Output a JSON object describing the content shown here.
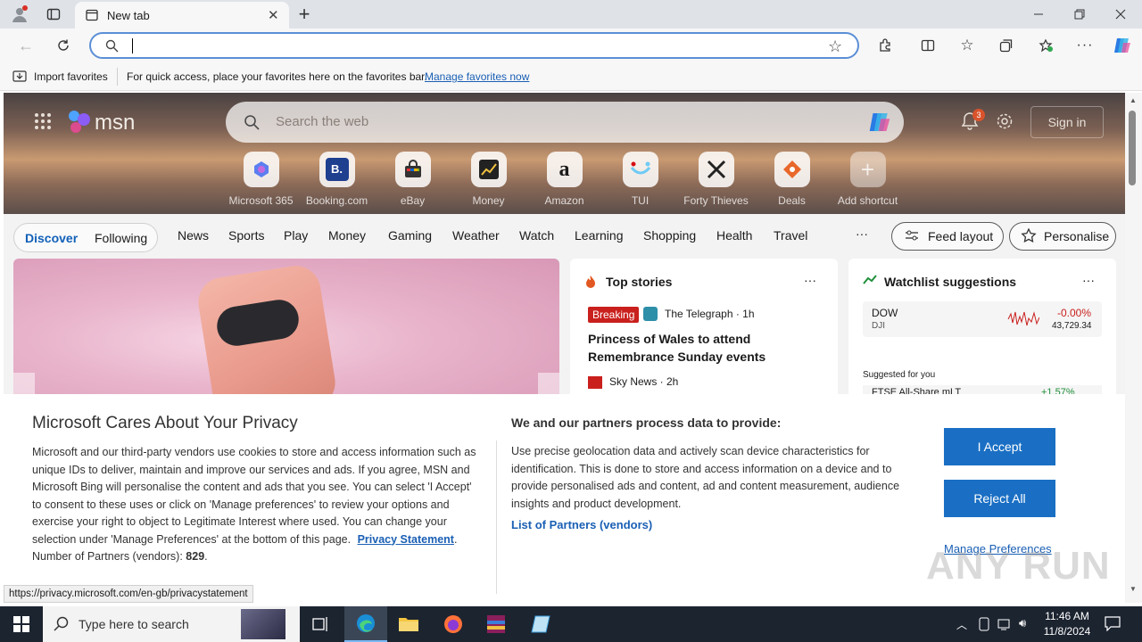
{
  "browser": {
    "tab_title": "New tab",
    "address_value": "",
    "favbar": {
      "import_label": "Import favorites",
      "hint_text": "For quick access, place your favorites here on the favorites bar.",
      "manage_link": "Manage favorites now"
    }
  },
  "msn": {
    "logo_text": "msn",
    "search_placeholder": "Search the web",
    "notification_count": "3",
    "sign_in_label": "Sign in",
    "shortcuts": [
      {
        "label": "Microsoft 365",
        "icon": "m365-icon"
      },
      {
        "label": "Booking.com",
        "icon": "booking-icon",
        "glyph": "B."
      },
      {
        "label": "eBay",
        "icon": "ebay-icon"
      },
      {
        "label": "Money",
        "icon": "money-icon"
      },
      {
        "label": "Amazon",
        "icon": "amazon-icon",
        "glyph": "a"
      },
      {
        "label": "TUI",
        "icon": "tui-icon"
      },
      {
        "label": "Forty Thieves",
        "icon": "forty-thieves-icon"
      },
      {
        "label": "Deals",
        "icon": "deals-icon"
      },
      {
        "label": "Add shortcut",
        "icon": "plus-icon",
        "glyph": "+"
      }
    ],
    "tabs": {
      "discover": "Discover",
      "following": "Following"
    },
    "nav_items": [
      "News",
      "Sports",
      "Play",
      "Money",
      "Gaming",
      "Weather",
      "Watch",
      "Learning",
      "Shopping",
      "Health",
      "Travel"
    ],
    "more_label": "···",
    "feed_layout_label": "Feed layout",
    "personalise_label": "Personalise",
    "top_stories": {
      "title": "Top stories",
      "more": "···",
      "breaking_badge": "Breaking",
      "source1": "The Telegraph · 1h",
      "headline1": "Princess of Wales to attend Remembrance Sunday events",
      "source2": "Sky News · 2h"
    },
    "watchlist": {
      "title": "Watchlist suggestions",
      "more": "···",
      "ticker": "DOW",
      "ticker_sub": "DJI",
      "change": "-0.00%",
      "price": "43,729.34",
      "suggested_label": "Suggested for you",
      "next_ticker": "FTSE All-Share mLT",
      "next_change": "+1.57%"
    }
  },
  "privacy": {
    "title": "Microsoft Cares About Your Privacy",
    "body": "Microsoft and our third-party vendors use cookies to store and access information such as unique IDs to deliver, maintain and improve our services and ads. If you agree, MSN and Microsoft Bing will personalise the content and ads that you see. You can select 'I Accept' to consent to these uses or click on 'Manage preferences' to review your options and exercise your right to object to Legitimate Interest where used.  You can change your selection under 'Manage Preferences' at the bottom of this page.",
    "privacy_link": "Privacy Statement",
    "partners_label": "Number of Partners (vendors): ",
    "partners_count": "829",
    "right_title": "We and our partners process data to provide:",
    "right_body": "Use precise geolocation data and actively scan device characteristics for identification. This is done to store and access information on a device and to provide personalised ads and content, ad and content measurement, audience insights and product development.",
    "list_link": "List of Partners (vendors)",
    "accept_label": "I Accept",
    "reject_label": "Reject All",
    "manage_label": "Manage Preferences"
  },
  "status_url": "https://privacy.microsoft.com/en-gb/privacystatement",
  "taskbar": {
    "search_placeholder": "Type here to search",
    "time": "11:46 AM",
    "date": "11/8/2024"
  },
  "watermark": "ANY RUN"
}
